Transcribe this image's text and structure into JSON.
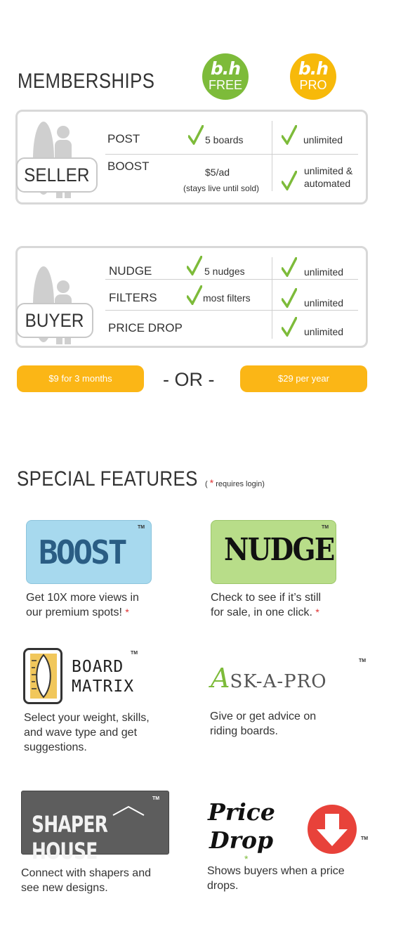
{
  "header": {
    "title": "MEMBERSHIPS"
  },
  "badges": {
    "free": {
      "logo": "b.h",
      "tier": "FREE"
    },
    "pro": {
      "logo": "b.h",
      "tier": "PRO"
    }
  },
  "seller": {
    "role": "SELLER",
    "rows": [
      {
        "feature": "POST",
        "free": "5 boards",
        "pro": "unlimited"
      },
      {
        "feature": "BOOST",
        "free": "$5/ad",
        "free_note": "(stays live until sold)",
        "pro_line1": "unlimited &",
        "pro_line2": "automated"
      }
    ]
  },
  "buyer": {
    "role": "BUYER",
    "rows": [
      {
        "feature": "NUDGE",
        "free": "5 nudges",
        "pro": "unlimited"
      },
      {
        "feature": "FILTERS",
        "free": "most filters",
        "pro": "unlimited"
      },
      {
        "feature": "PRICE DROP",
        "pro": "unlimited"
      }
    ]
  },
  "pricing": {
    "option1": "$9  for 3 months",
    "separator": "- OR -",
    "option2": "$29 per year"
  },
  "special": {
    "title": "SPECIAL FEATURES",
    "note_open": "(",
    "note_star": "*",
    "note_text": "requires login)",
    "features": [
      {
        "logo": "BOOST",
        "tm": "TM",
        "desc_line1": "Get 10X more views in",
        "desc_line2": "our premium spots!",
        "star": "*"
      },
      {
        "logo": "NUDGE",
        "tm": "TM",
        "desc_line1": "Check to see if it’s still",
        "desc_line2": "for sale, in one click.",
        "star": "*"
      },
      {
        "logo_line1": "BOARD",
        "logo_line2": "MATRIX",
        "tm": "TM",
        "desc_line1": "Select your weight, skills,",
        "desc_line2": "and wave type and get",
        "desc_line3": "suggestions."
      },
      {
        "logo_cap": "A",
        "logo_rest": "SK-A-PRO",
        "tm": "TM",
        "desc_line1": "Give or get advice on",
        "desc_line2": "riding boards."
      },
      {
        "logo": "SHAPER HOUSE",
        "tm": "TM",
        "desc_line1": "Connect with shapers and",
        "desc_line2": "see new designs."
      },
      {
        "logo_line1": "Price",
        "logo_line2": "Drop",
        "tm": "TM",
        "star": "*",
        "desc_line1": "Shows buyers when a price",
        "desc_line2": "drops."
      }
    ]
  },
  "colors": {
    "green": "#7dbb3a",
    "gold": "#f7b90a",
    "button": "#fbb616",
    "red": "#e8423a"
  }
}
